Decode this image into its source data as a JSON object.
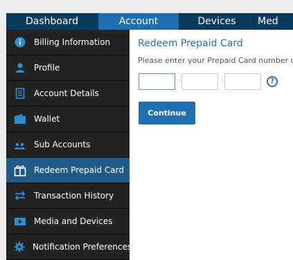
{
  "top_nav": {
    "tabs": [
      {
        "label": "Dashboard",
        "active": false
      },
      {
        "label": "Account",
        "active": true
      },
      {
        "label": "Devices",
        "active": false
      },
      {
        "label": "Med",
        "active": false
      }
    ]
  },
  "sidebar": {
    "items": [
      {
        "label": "Billing Information",
        "icon": "info-icon",
        "active": false
      },
      {
        "label": "Profile",
        "icon": "user-icon",
        "active": false
      },
      {
        "label": "Account Details",
        "icon": "document-icon",
        "active": false
      },
      {
        "label": "Wallet",
        "icon": "wallet-icon",
        "active": false
      },
      {
        "label": "Sub Accounts",
        "icon": "users-icon",
        "active": false
      },
      {
        "label": "Redeem Prepaid Card",
        "icon": "gift-icon",
        "active": true
      },
      {
        "label": "Transaction History",
        "icon": "transfer-icon",
        "active": false
      },
      {
        "label": "Media and Devices",
        "icon": "media-icon",
        "active": false
      },
      {
        "label": "Notification Preferences",
        "icon": "gear-icon",
        "active": false
      }
    ]
  },
  "main": {
    "title": "Redeem Prepaid Card",
    "description": "Please enter your Prepaid Card number or Prom",
    "code_fields": [
      {
        "value": "",
        "placeholder": ""
      },
      {
        "value": "",
        "placeholder": ""
      },
      {
        "value": "",
        "placeholder": ""
      }
    ],
    "separator": "-",
    "help_label": "?",
    "continue_label": "Continue"
  },
  "colors": {
    "nav_bg": "#0a3a5c",
    "nav_active": "#1f6fb0",
    "sidebar_bg": "#232323",
    "sidebar_active": "#1f5b86",
    "accent": "#2a6fb0"
  }
}
